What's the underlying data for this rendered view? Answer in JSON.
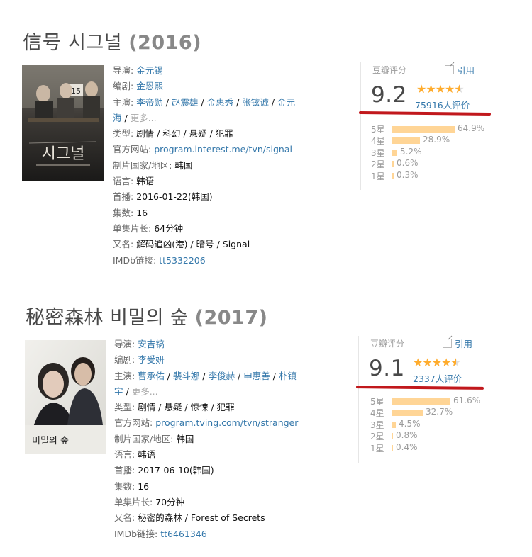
{
  "entries": [
    {
      "title": "信号 시그널",
      "year": "(2016)",
      "poster": {
        "title_text": "시그널",
        "number_text": "15"
      },
      "info": {
        "director_label": "导演:",
        "director": "金元锡",
        "writer_label": "编剧:",
        "writer": "金恩熙",
        "cast_label": "主演:",
        "cast_line1": [
          "李帝勋",
          "赵震雄",
          "金惠秀",
          "张铉诚"
        ],
        "cast_line1_tail": "金元",
        "cast_line2_head": "海",
        "more": "更多...",
        "genre_label": "类型:",
        "genre": "剧情 / 科幻 / 悬疑 / 犯罪",
        "site_label": "官方网站:",
        "site": "program.interest.me/tvn/signal",
        "country_label": "制片国家/地区:",
        "country": "韩国",
        "lang_label": "语言:",
        "lang": "韩语",
        "premiere_label": "首播:",
        "premiere": "2016-01-22(韩国)",
        "episodes_label": "集数:",
        "episodes": "16",
        "runtime_label": "单集片长:",
        "runtime": "64分钟",
        "aka_label": "又名:",
        "aka": "解码追凶(港) / 暗号 / Signal",
        "imdb_label": "IMDb链接:",
        "imdb": "tt5332206"
      },
      "rating": {
        "label": "豆瓣评分",
        "cite": "引用",
        "score": "9.2",
        "stars": 4.5,
        "votes": "75916人评价",
        "distribution": [
          {
            "label": "5星",
            "pct": "64.9%",
            "value": 64.9
          },
          {
            "label": "4星",
            "pct": "28.9%",
            "value": 28.9
          },
          {
            "label": "3星",
            "pct": "5.2%",
            "value": 5.2
          },
          {
            "label": "2星",
            "pct": "0.6%",
            "value": 0.6
          },
          {
            "label": "1星",
            "pct": "0.3%",
            "value": 0.3
          }
        ]
      }
    },
    {
      "title": "秘密森林 비밀의 숲",
      "year": "(2017)",
      "poster": {
        "title_text": "비밀의 숲"
      },
      "info": {
        "director_label": "导演:",
        "director": "安吉镐",
        "writer_label": "编剧:",
        "writer": "李受妍",
        "cast_label": "主演:",
        "cast_line1": [
          "曹承佑",
          "裴斗娜",
          "李俊赫",
          "申惠善"
        ],
        "cast_line1_tail": "朴镇",
        "cast_line2_head": "宇",
        "more": "更多...",
        "genre_label": "类型:",
        "genre": "剧情 / 悬疑 / 惊悚 / 犯罪",
        "site_label": "官方网站:",
        "site": "program.tving.com/tvn/stranger",
        "country_label": "制片国家/地区:",
        "country": "韩国",
        "lang_label": "语言:",
        "lang": "韩语",
        "premiere_label": "首播:",
        "premiere": "2017-06-10(韩国)",
        "episodes_label": "集数:",
        "episodes": "16",
        "runtime_label": "单集片长:",
        "runtime": "70分钟",
        "aka_label": "又名:",
        "aka": "秘密的森林 / Forest of Secrets",
        "imdb_label": "IMDb链接:",
        "imdb": "tt6461346"
      },
      "rating": {
        "label": "豆瓣评分",
        "cite": "引用",
        "score": "9.1",
        "stars": 4.5,
        "votes": "2337人评价",
        "distribution": [
          {
            "label": "5星",
            "pct": "61.6%",
            "value": 61.6
          },
          {
            "label": "4星",
            "pct": "32.7%",
            "value": 32.7
          },
          {
            "label": "3星",
            "pct": "4.5%",
            "value": 4.5
          },
          {
            "label": "2星",
            "pct": "0.8%",
            "value": 0.8
          },
          {
            "label": "1星",
            "pct": "0.4%",
            "value": 0.4
          }
        ]
      }
    }
  ],
  "colors": {
    "link": "#3377aa",
    "star": "#ffac2d",
    "bar": "#ffd596",
    "highlight": "#c1181c"
  }
}
